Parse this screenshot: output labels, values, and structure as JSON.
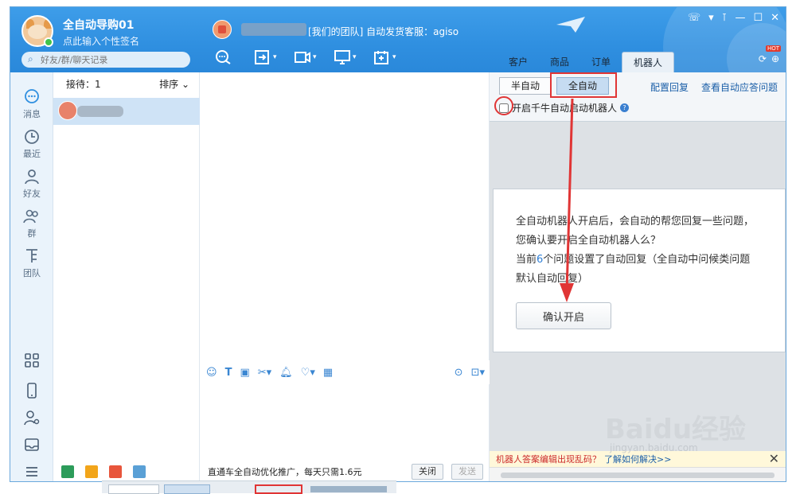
{
  "user": {
    "name": "全自动导购01",
    "signature": "点此输入个性签名"
  },
  "search": {
    "placeholder": "好友/群/聊天记录"
  },
  "chat_header": {
    "title": "[我们的团队] 自动发货客服：agiso"
  },
  "right_tabs": [
    {
      "label": "客户"
    },
    {
      "label": "商品"
    },
    {
      "label": "订单"
    },
    {
      "label": "机器人"
    }
  ],
  "hot_badge": "HOT",
  "nav": [
    {
      "label": "消息",
      "icon": "message-icon"
    },
    {
      "label": "最近",
      "icon": "clock-icon"
    },
    {
      "label": "好友",
      "icon": "friend-icon"
    },
    {
      "label": "群",
      "icon": "group-icon"
    },
    {
      "label": "团队",
      "icon": "team-icon"
    }
  ],
  "contacts": {
    "header_label": "接待：1",
    "sort_label": "排序"
  },
  "chat_footer": {
    "promo": "直通车全自动优化推广，每天只需1.6元",
    "close_label": "关闭",
    "send_label": "发送"
  },
  "robot": {
    "semi_auto": "半自动",
    "full_auto": "全自动",
    "config_reply": "配置回复",
    "view_questions": "查看自动应答问题",
    "enable_checkbox": "开启千牛自动启动机器人"
  },
  "dialog": {
    "line1": "全自动机器人开启后，会自动的帮您回复一些问题，",
    "line2": "您确认要开启全自动机器人么？",
    "line3_pre": "当前",
    "line3_count": "6",
    "line3_post": "个问题设置了自动回复（全自动中问候类问题",
    "line4": "默认自动回复）",
    "confirm": "确认开启"
  },
  "notice": {
    "text": "机器人答案编辑出现乱码？",
    "link": "了解如何解决>>"
  },
  "watermark": {
    "brand": "Baidu经验",
    "url": "jingyan.baidu.com"
  },
  "colors": {
    "titlebar": "#2f8fe0",
    "highlight": "#e03535",
    "link": "#1b5fa8"
  }
}
